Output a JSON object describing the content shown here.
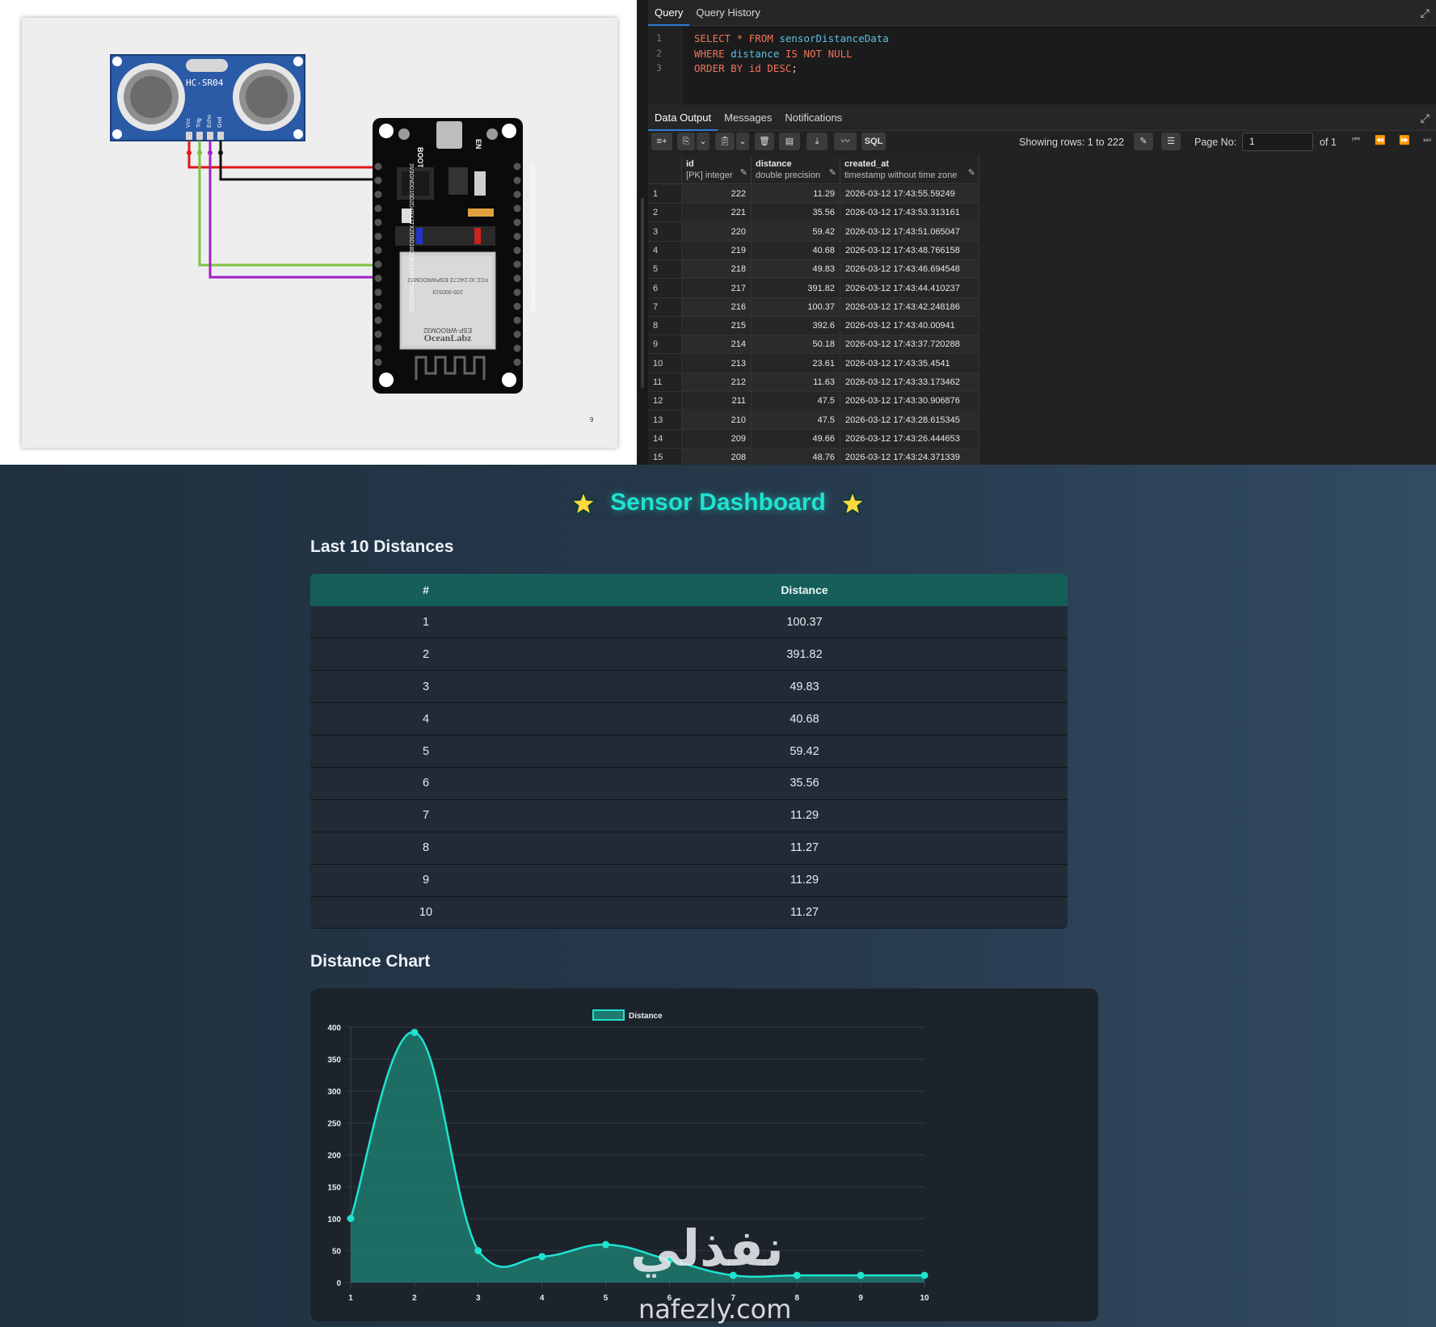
{
  "circuit": {
    "sensor_label": "HC-SR04",
    "sensor_pins": [
      "Vcc",
      "Trig",
      "Echo",
      "Gnd"
    ],
    "board_labels": {
      "boot": "BOOT",
      "en": "EN",
      "module": "ESP-WROOM32",
      "brand": "OceanLabz",
      "fcc": "FCC ID:2AC7Z-ESPWROOM32",
      "cert": "205-000519",
      "left_pins": "3V3GNDD15D2D4RX2TX2D5D18D19D21RX0TX0D22D23",
      "right_pins": "VinGNDD13D12D14D27D26D25D33D32D35D34VNVPEN"
    },
    "page_marker": "9"
  },
  "pgadmin": {
    "query_tabs": [
      "Query",
      "Query History"
    ],
    "query_lines": [
      {
        "n": "1",
        "parts": [
          [
            "kw",
            "SELECT * FROM "
          ],
          [
            "tbl",
            "sensorDistanceData"
          ]
        ]
      },
      {
        "n": "2",
        "parts": [
          [
            "kw",
            "WHERE "
          ],
          [
            "tbl",
            "distance "
          ],
          [
            "kw",
            "IS NOT NULL"
          ]
        ]
      },
      {
        "n": "3",
        "parts": [
          [
            "kw",
            "ORDER BY "
          ],
          [
            "kw",
            "id DESC"
          ],
          [
            "plain",
            ";"
          ]
        ]
      }
    ],
    "result_tabs": [
      "Data Output",
      "Messages",
      "Notifications"
    ],
    "showing_rows": "Showing rows: 1 to 222",
    "page_no_label": "Page No:",
    "page_no_value": "1",
    "page_of": "of 1",
    "sql_button": "SQL",
    "columns": [
      {
        "name": "id",
        "type": "[PK] integer"
      },
      {
        "name": "distance",
        "type": "double precision"
      },
      {
        "name": "created_at",
        "type": "timestamp without time zone"
      }
    ],
    "rows": [
      [
        "1",
        "222",
        "11.29",
        "2026-03-12 17:43:55.59249"
      ],
      [
        "2",
        "221",
        "35.56",
        "2026-03-12 17:43:53.313161"
      ],
      [
        "3",
        "220",
        "59.42",
        "2026-03-12 17:43:51.065047"
      ],
      [
        "4",
        "219",
        "40.68",
        "2026-03-12 17:43:48.766158"
      ],
      [
        "5",
        "218",
        "49.83",
        "2026-03-12 17:43:46.694548"
      ],
      [
        "6",
        "217",
        "391.82",
        "2026-03-12 17:43:44.410237"
      ],
      [
        "7",
        "216",
        "100.37",
        "2026-03-12 17:43:42.248186"
      ],
      [
        "8",
        "215",
        "392.6",
        "2026-03-12 17:43:40.00941"
      ],
      [
        "9",
        "214",
        "50.18",
        "2026-03-12 17:43:37.720288"
      ],
      [
        "10",
        "213",
        "23.61",
        "2026-03-12 17:43:35.4541"
      ],
      [
        "11",
        "212",
        "11.63",
        "2026-03-12 17:43:33.173462"
      ],
      [
        "12",
        "211",
        "47.5",
        "2026-03-12 17:43:30.906876"
      ],
      [
        "13",
        "210",
        "47.5",
        "2026-03-12 17:43:28.615345"
      ],
      [
        "14",
        "209",
        "49.66",
        "2026-03-12 17:43:26.444653"
      ],
      [
        "15",
        "208",
        "48.76",
        "2026-03-12 17:43:24.371339"
      ]
    ]
  },
  "dashboard": {
    "title": "Sensor Dashboard",
    "table_heading": "Last 10 Distances",
    "table_headers": [
      "#",
      "Distance"
    ],
    "table_rows": [
      [
        "1",
        "100.37"
      ],
      [
        "2",
        "391.82"
      ],
      [
        "3",
        "49.83"
      ],
      [
        "4",
        "40.68"
      ],
      [
        "5",
        "59.42"
      ],
      [
        "6",
        "35.56"
      ],
      [
        "7",
        "11.29"
      ],
      [
        "8",
        "11.27"
      ],
      [
        "9",
        "11.29"
      ],
      [
        "10",
        "11.27"
      ]
    ],
    "chart_heading": "Distance Chart"
  },
  "chart_data": {
    "type": "area",
    "x": [
      "1",
      "2",
      "3",
      "4",
      "5",
      "6",
      "7",
      "8",
      "9",
      "10"
    ],
    "series": [
      {
        "name": "Distance",
        "values": [
          100.37,
          391.82,
          49.83,
          40.68,
          59.42,
          35.56,
          11.29,
          11.27,
          11.29,
          11.27
        ]
      }
    ],
    "ylim": [
      0,
      400
    ],
    "yticks": [
      0,
      50,
      100,
      150,
      200,
      250,
      300,
      350,
      400
    ],
    "legend": "top-center",
    "grid": true,
    "line_color": "#1ee3d0",
    "fill_color": "#1f7a70"
  },
  "watermark": {
    "arabic": "نفذلي",
    "url": "nafezly.com"
  },
  "colors": {
    "accent": "#1ee3d0",
    "table_header": "#165e5a",
    "keyword": "#f2735a",
    "identifier": "#5cc2e6"
  }
}
